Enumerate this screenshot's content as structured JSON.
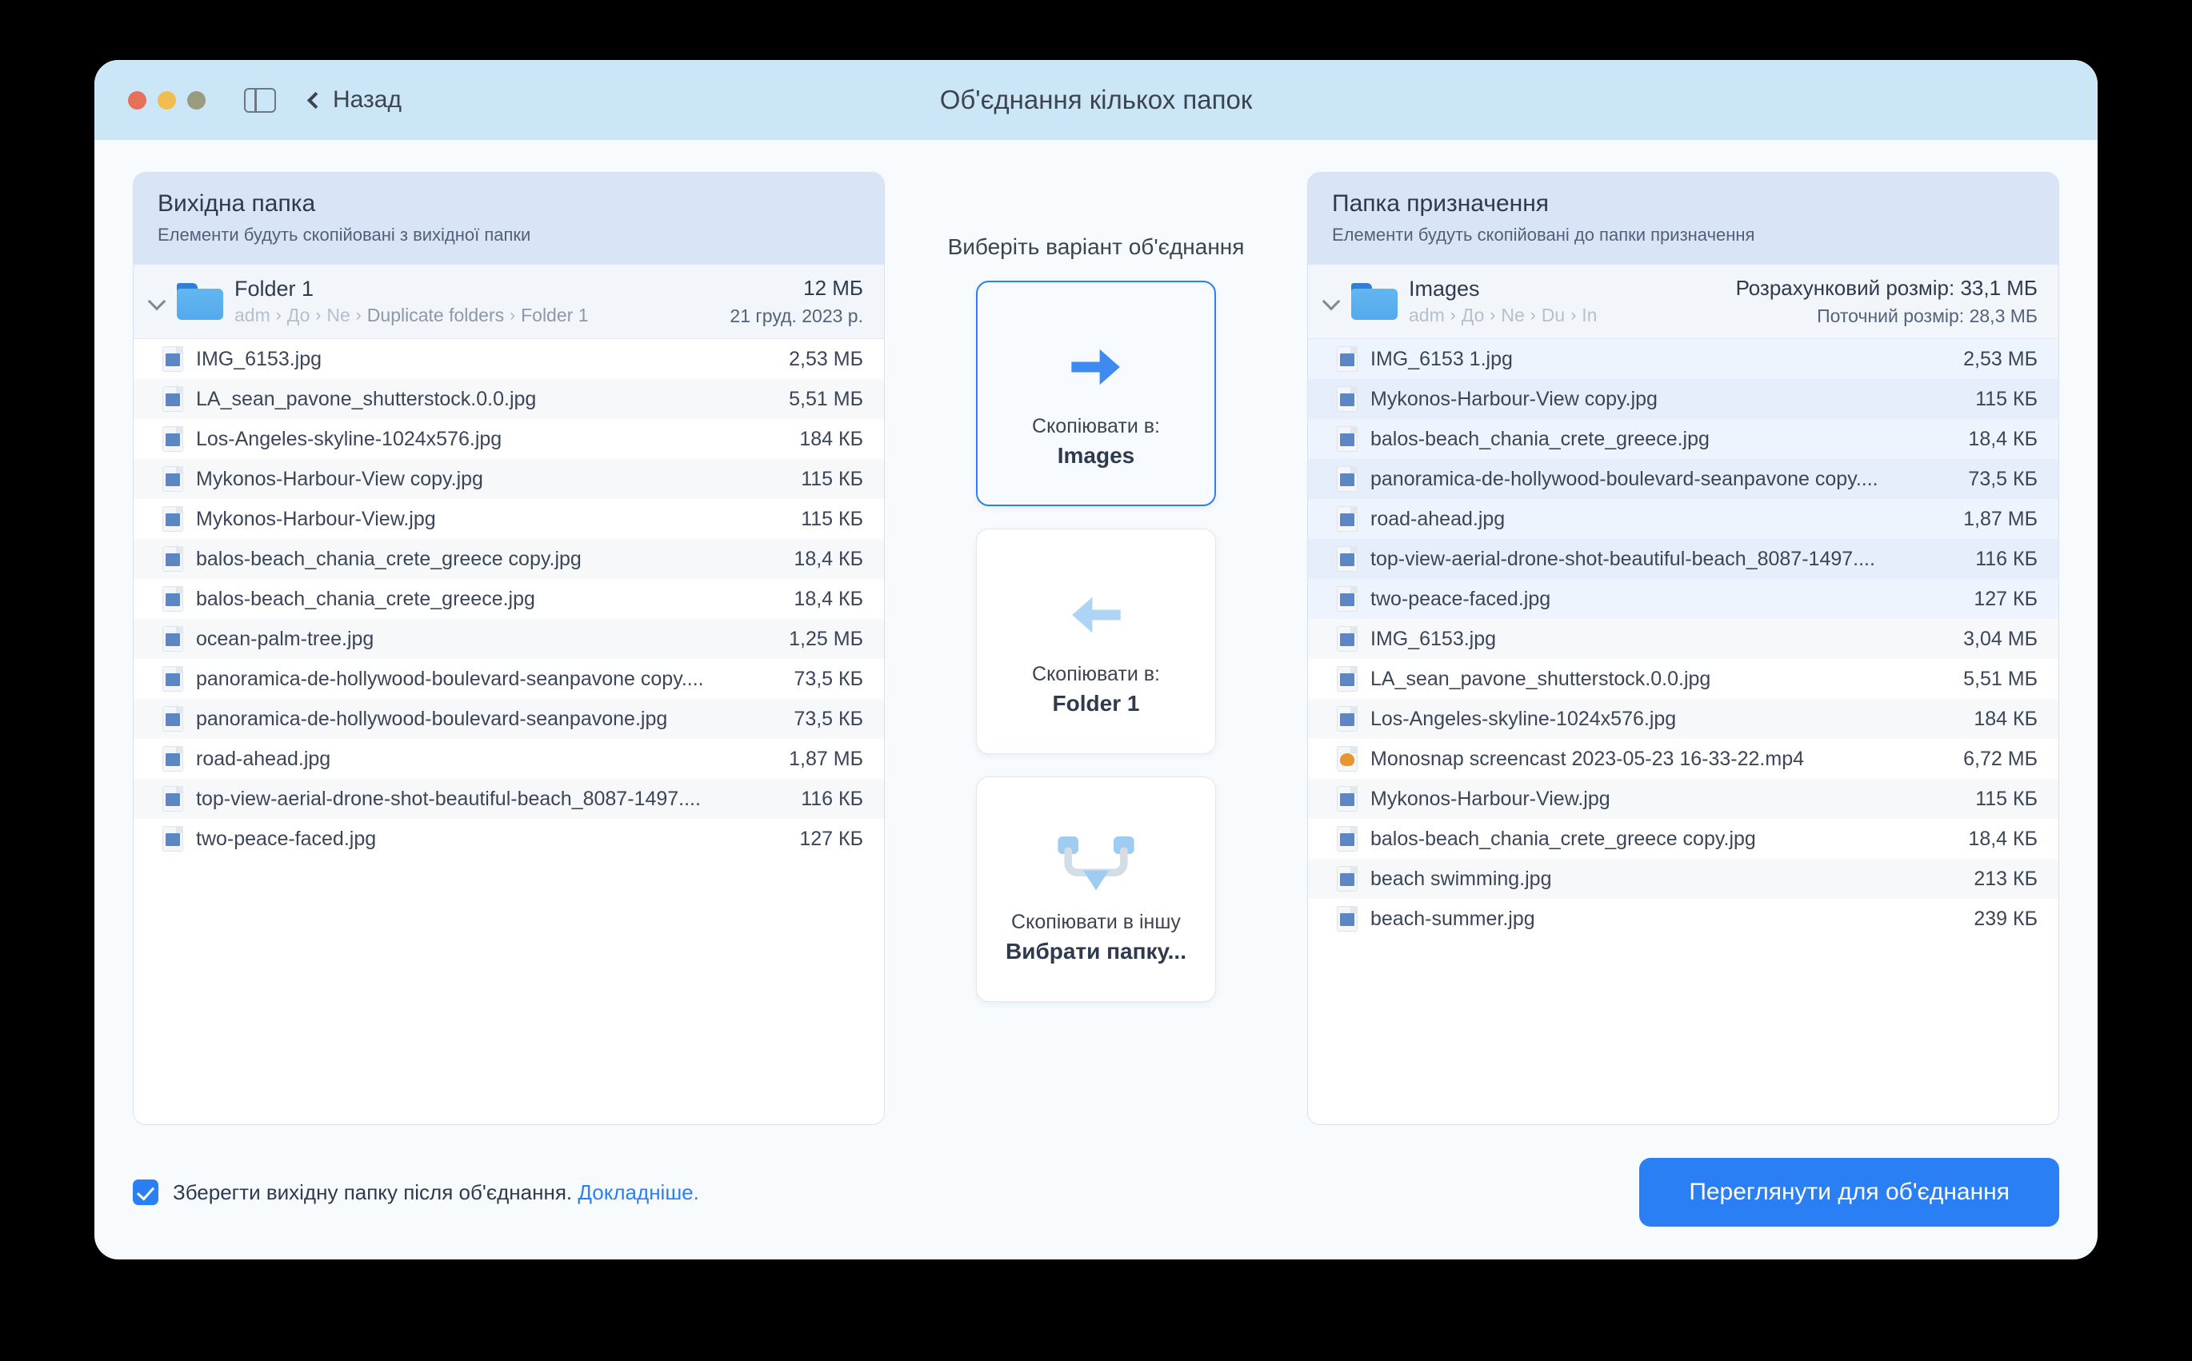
{
  "window": {
    "title": "Об'єднання кількох папок",
    "back_label": "Назад",
    "traffic": {
      "close": "close-button",
      "minimize": "minimize-button",
      "zoom": "zoom-button"
    }
  },
  "source_panel": {
    "heading": "Вихідна папка",
    "subheading": "Елементи будуть скопійовані з вихідної папки",
    "folder": {
      "name": "Folder 1",
      "crumbs": [
        "adm",
        "До",
        "Ne",
        "Duplicate folders",
        "Folder 1"
      ],
      "size": "12 МБ",
      "date": "21 груд. 2023 р."
    },
    "files": [
      {
        "name": "IMG_6153.jpg",
        "size": "2,53 МБ",
        "kind": "image"
      },
      {
        "name": "LA_sean_pavone_shutterstock.0.0.jpg",
        "size": "5,51 МБ",
        "kind": "image"
      },
      {
        "name": "Los-Angeles-skyline-1024x576.jpg",
        "size": "184 КБ",
        "kind": "image"
      },
      {
        "name": "Mykonos-Harbour-View copy.jpg",
        "size": "115 КБ",
        "kind": "image"
      },
      {
        "name": "Mykonos-Harbour-View.jpg",
        "size": "115 КБ",
        "kind": "image"
      },
      {
        "name": "balos-beach_chania_crete_greece copy.jpg",
        "size": "18,4 КБ",
        "kind": "image"
      },
      {
        "name": "balos-beach_chania_crete_greece.jpg",
        "size": "18,4 КБ",
        "kind": "image"
      },
      {
        "name": "ocean-palm-tree.jpg",
        "size": "1,25 МБ",
        "kind": "image"
      },
      {
        "name": "panoramica-de-hollywood-boulevard-seanpavone copy....",
        "size": "73,5 КБ",
        "kind": "image"
      },
      {
        "name": "panoramica-de-hollywood-boulevard-seanpavone.jpg",
        "size": "73,5 КБ",
        "kind": "image"
      },
      {
        "name": "road-ahead.jpg",
        "size": "1,87 МБ",
        "kind": "image"
      },
      {
        "name": "top-view-aerial-drone-shot-beautiful-beach_8087-1497....",
        "size": "116 КБ",
        "kind": "image"
      },
      {
        "name": "two-peace-faced.jpg",
        "size": "127 КБ",
        "kind": "image"
      }
    ]
  },
  "merge_options": {
    "title": "Виберіть варіант об'єднання",
    "cards": [
      {
        "icon": "arrow-right-icon",
        "label_top": "Скопіювати в:",
        "label_bottom": "Images",
        "selected": true
      },
      {
        "icon": "arrow-left-icon",
        "label_top": "Скопіювати в:",
        "label_bottom": "Folder 1",
        "selected": false
      },
      {
        "icon": "merge-down-icon",
        "label_top": "Скопіювати в іншу",
        "label_bottom": "Вибрати папку...",
        "selected": false
      }
    ]
  },
  "destination_panel": {
    "heading": "Папка призначення",
    "subheading": "Елементи будуть скопійовані до папки призначення",
    "folder": {
      "name": "Images",
      "crumbs": [
        "adm",
        "До",
        "Ne",
        "Du",
        "In"
      ],
      "estimated_size": "Розрахунковий розмір: 33,1 МБ",
      "current_size": "Поточний розмір: 28,3 МБ"
    },
    "files": [
      {
        "name": "IMG_6153 1.jpg",
        "size": "2,53 МБ",
        "kind": "image",
        "new": true
      },
      {
        "name": "Mykonos-Harbour-View copy.jpg",
        "size": "115 КБ",
        "kind": "image",
        "new": true
      },
      {
        "name": "balos-beach_chania_crete_greece.jpg",
        "size": "18,4 КБ",
        "kind": "image",
        "new": true
      },
      {
        "name": "panoramica-de-hollywood-boulevard-seanpavone copy....",
        "size": "73,5 КБ",
        "kind": "image",
        "new": true
      },
      {
        "name": "road-ahead.jpg",
        "size": "1,87 МБ",
        "kind": "image",
        "new": true
      },
      {
        "name": "top-view-aerial-drone-shot-beautiful-beach_8087-1497....",
        "size": "116 КБ",
        "kind": "image",
        "new": true
      },
      {
        "name": "two-peace-faced.jpg",
        "size": "127 КБ",
        "kind": "image",
        "new": true
      },
      {
        "name": "IMG_6153.jpg",
        "size": "3,04 МБ",
        "kind": "image",
        "new": false
      },
      {
        "name": "LA_sean_pavone_shutterstock.0.0.jpg",
        "size": "5,51 МБ",
        "kind": "image",
        "new": false
      },
      {
        "name": "Los-Angeles-skyline-1024x576.jpg",
        "size": "184 КБ",
        "kind": "image",
        "new": false
      },
      {
        "name": "Monosnap screencast 2023-05-23 16-33-22.mp4",
        "size": "6,72 МБ",
        "kind": "video",
        "new": false
      },
      {
        "name": "Mykonos-Harbour-View.jpg",
        "size": "115 КБ",
        "kind": "image",
        "new": false
      },
      {
        "name": "balos-beach_chania_crete_greece copy.jpg",
        "size": "18,4 КБ",
        "kind": "image",
        "new": false
      },
      {
        "name": "beach swimming.jpg",
        "size": "213 КБ",
        "kind": "image",
        "new": false
      },
      {
        "name": "beach-summer.jpg",
        "size": "239 КБ",
        "kind": "image",
        "new": false
      }
    ]
  },
  "footer": {
    "checkbox_checked": true,
    "checkbox_label": "Зберегти вихідну папку після об'єднання.",
    "link_label": "Докладніше.",
    "primary_button": "Переглянути для об'єднання"
  },
  "colors": {
    "accent": "#2b7ff5",
    "titlebar": "#cbe7f7",
    "panel_head": "#d9e4f7",
    "new_row": "#eef4fd"
  }
}
